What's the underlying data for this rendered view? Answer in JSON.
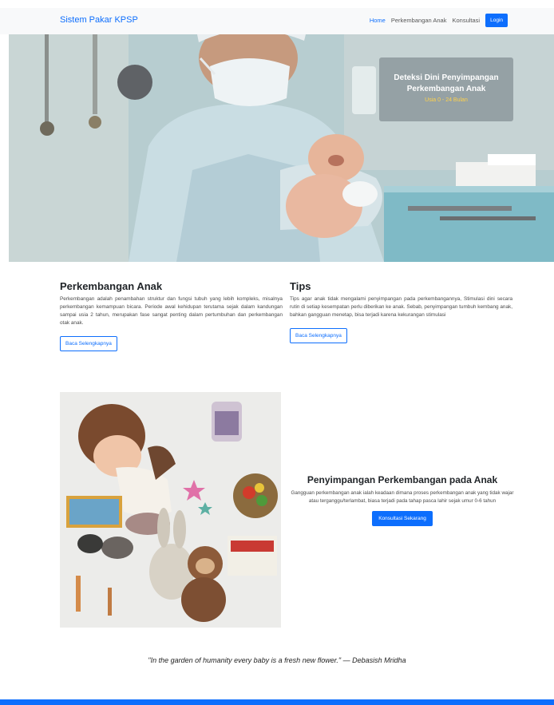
{
  "navbar": {
    "brand": "Sistem Pakar KPSP",
    "links": [
      "Home",
      "Perkembangan Anak",
      "Konsultasi"
    ],
    "login_label": "Login"
  },
  "hero": {
    "title_line1": "Deteksi Dini Penyimpangan",
    "title_line2": "Perkembangan Anak",
    "subtitle": "Usia 0 - 24 Bulan"
  },
  "articles": [
    {
      "title": "Perkembangan Anak",
      "body": "Perkembangan adalah penambahan struktur dan fungsi tubuh yang lebih kompleks, misalnya perkembangan kemampuan bicara. Periode awal kehidupan terutama sejak dalam kandungan sampai usia 2 tahun, merupakan fase sangat penting dalam pertumbuhan dan perkembangan otak anak.",
      "button": "Baca Selengkapnya"
    },
    {
      "title": "Tips",
      "body": "Tips agar anak tidak mengalami penyimpangan pada perkembangannya, Stimulasi dini secara rutin di setiap kesempatan perlu diberikan ke anak. Sebab, penyimpangan tumbuh kembang anak, bahkan gangguan menetap, bisa terjadi karena kekurangan stimulasi",
      "button": "Baca Selengkapnya"
    }
  ],
  "deviation": {
    "title": "Penyimpangan Perkembangan pada Anak",
    "body": "Gangguan perkembangan anak ialah keadaan dimana proses perkembangan anak yang tidak wajar atau terganggu/terlambat, biasa terjadi pada tahap pasca lahir sejak umur 0-6 tahun",
    "button": "Konsultasi Sekarang"
  },
  "quote": "\"In the garden of humanity every baby is a fresh new flower.\" — Debasish Mridha",
  "colors": {
    "primary": "#0d6efd",
    "navbar_bg": "#f8f9fa",
    "hero_accent": "#ffd24a"
  }
}
